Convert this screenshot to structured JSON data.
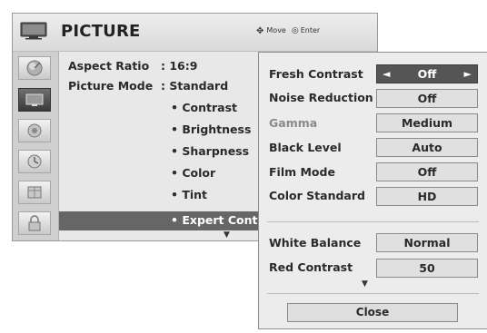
{
  "menu": {
    "title": "PICTURE",
    "nav_hint": {
      "move_label": "Move",
      "enter_label": "Enter"
    },
    "sidebar": [
      {
        "icon": "satellite-dish-icon",
        "active": false
      },
      {
        "icon": "picture-tv-icon",
        "active": true
      },
      {
        "icon": "audio-speaker-icon",
        "active": false
      },
      {
        "icon": "clock-icon",
        "active": false
      },
      {
        "icon": "option-grid-icon",
        "active": false
      },
      {
        "icon": "lock-icon",
        "active": false
      }
    ],
    "items": {
      "aspect_ratio": {
        "label": "Aspect Ratio",
        "value": ": 16:9"
      },
      "picture_mode": {
        "label": "Picture Mode",
        "value": ": Standard"
      },
      "sub": [
        "• Contrast",
        "• Brightness",
        "• Sharpness",
        "• Color",
        "• Tint",
        "• Expert Cont"
      ]
    },
    "more_arrow": "▼"
  },
  "expert": {
    "rows": [
      {
        "label": "Fresh Contrast",
        "value": "Off"
      },
      {
        "label": "Noise Reduction",
        "value": "Off"
      },
      {
        "label": "Gamma",
        "value": "Medium"
      },
      {
        "label": "Black Level",
        "value": "Auto"
      },
      {
        "label": "Film Mode",
        "value": "Off"
      },
      {
        "label": "Color Standard",
        "value": "HD"
      }
    ],
    "rows2": [
      {
        "label": "White Balance",
        "value": "Normal"
      },
      {
        "label": "Red Contrast",
        "value": "50"
      }
    ],
    "arrow_left": "◄",
    "arrow_right": "►",
    "more_arrow": "▼",
    "close_label": "Close"
  }
}
